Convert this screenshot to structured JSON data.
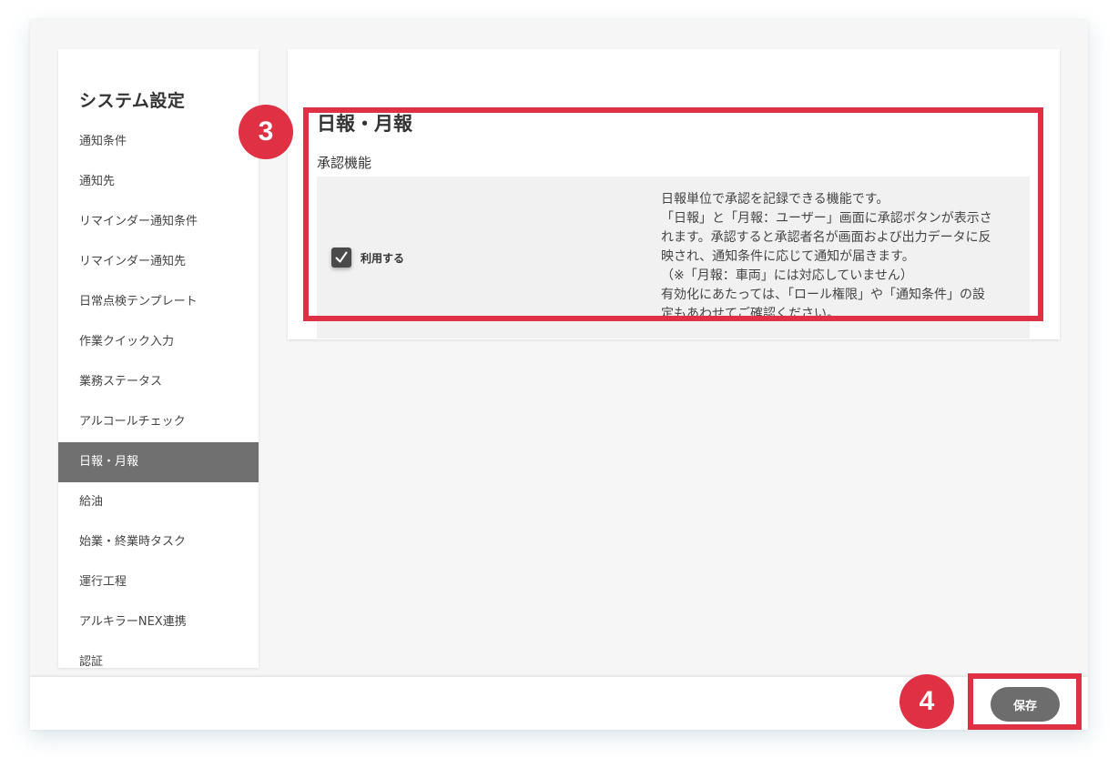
{
  "sidebar": {
    "title": "システム設定",
    "items": [
      {
        "label": "通知条件",
        "active": false
      },
      {
        "label": "通知先",
        "active": false
      },
      {
        "label": "リマインダー通知条件",
        "active": false
      },
      {
        "label": "リマインダー通知先",
        "active": false
      },
      {
        "label": "日常点検テンプレート",
        "active": false
      },
      {
        "label": "作業クイック入力",
        "active": false
      },
      {
        "label": "業務ステータス",
        "active": false
      },
      {
        "label": "アルコールチェック",
        "active": false
      },
      {
        "label": "日報・月報",
        "active": true
      },
      {
        "label": "給油",
        "active": false
      },
      {
        "label": "始業・終業時タスク",
        "active": false
      },
      {
        "label": "運行工程",
        "active": false
      },
      {
        "label": "アルキラーNEX連携",
        "active": false
      },
      {
        "label": "認証",
        "active": false
      }
    ]
  },
  "main": {
    "title": "日報・月報",
    "section_label": "承認機能",
    "checkbox": {
      "label": "利用する",
      "checked": true
    },
    "description_lines": [
      "日報単位で承認を記録できる機能です。",
      "「日報」と「月報：ユーザー」画面に承認ボタンが表示さ",
      "れます。承認すると承認者名が画面および出力データに反",
      "映され、通知条件に応じて通知が届きます。",
      "（※「月報：車両」には対応していません）",
      "有効化にあたっては、「ロール権限」や「通知条件」の設",
      "定もあわせてご確認ください。"
    ]
  },
  "footer": {
    "save_label": "保存"
  },
  "annotations": [
    {
      "number": "3"
    },
    {
      "number": "4"
    }
  ],
  "colors": {
    "accent": "#e03044",
    "active_nav": "#707070",
    "button": "#6d6d6d"
  },
  "icons": {
    "checkbox": "check-icon"
  }
}
